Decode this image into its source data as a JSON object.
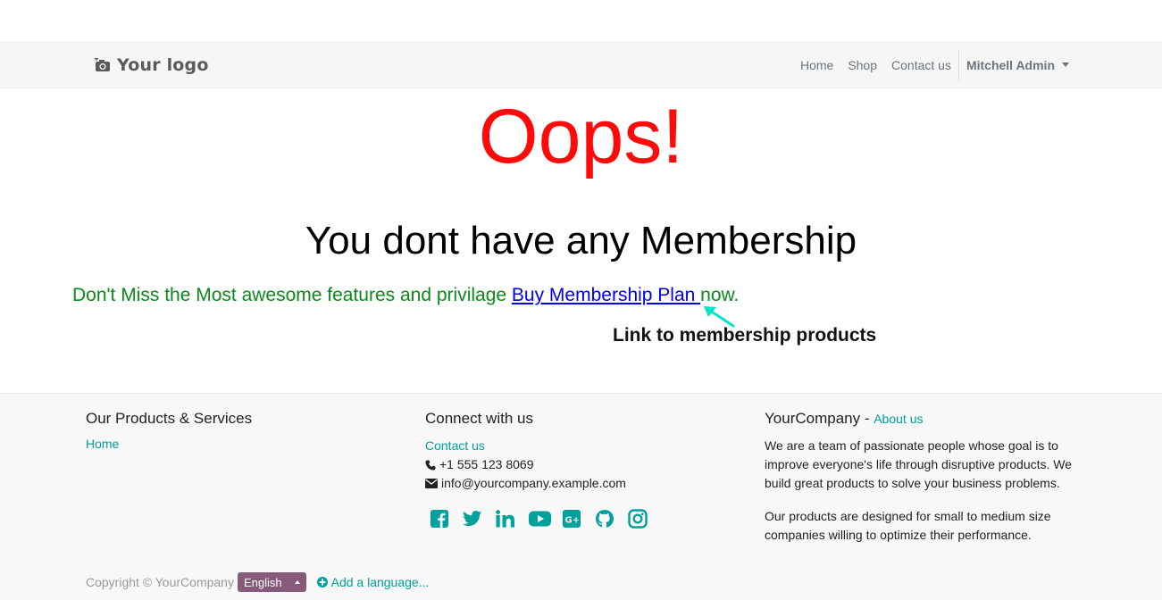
{
  "header": {
    "logo_text": "Your logo",
    "nav": [
      {
        "label": "Home"
      },
      {
        "label": "Shop"
      },
      {
        "label": "Contact us"
      }
    ],
    "user": "Mitchell Admin"
  },
  "main": {
    "oops": "Oops!",
    "headline": "You dont have any Membership",
    "promo_text": "Don't Miss the Most awesome features and privilage ",
    "promo_link": "Buy Membership Plan ",
    "promo_after": "now.",
    "annotation": "Link to membership products"
  },
  "footer": {
    "products": {
      "title": "Our Products & Services",
      "links": [
        "Home"
      ]
    },
    "connect": {
      "title": "Connect with us",
      "contact_link": "Contact us",
      "phone": "+1 555 123 8069",
      "email": "info@yourcompany.example.com",
      "social_icons": [
        "facebook-icon",
        "twitter-icon",
        "linkedin-icon",
        "youtube-icon",
        "google-plus-icon",
        "github-icon",
        "instagram-icon"
      ]
    },
    "company": {
      "name": "YourCompany",
      "separator": " - ",
      "about_link": "About us",
      "desc1": "We are a team of passionate people whose goal is to improve everyone's life through disruptive products. We build great products to solve your business problems.",
      "desc2": "Our products are designed for small to medium size companies willing to optimize their performance."
    },
    "copyright": "Copyright © YourCompany",
    "language": "English",
    "add_language": "Add a language..."
  },
  "colors": {
    "accent": "#00a09d",
    "oops": "#ff0a0a",
    "promo": "#0b8a1a",
    "link": "#0000ee",
    "lang_badge": "#875a7b",
    "arrow": "#00e6c8"
  }
}
